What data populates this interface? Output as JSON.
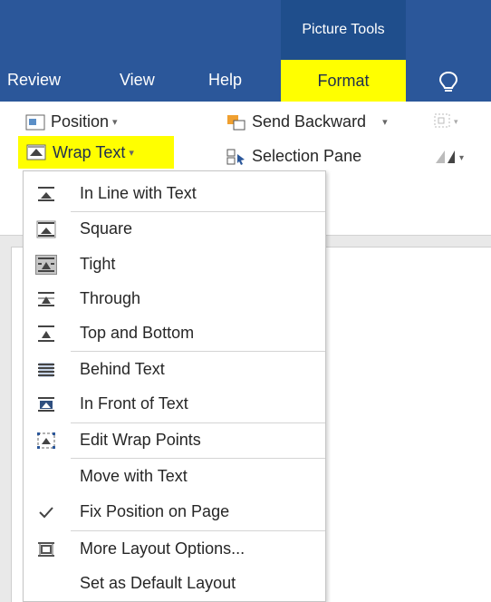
{
  "ribbon": {
    "context_group": "Picture Tools",
    "tabs": [
      "Review",
      "View",
      "Help"
    ],
    "active_tab": "Format",
    "tell_me_icon": "lightbulb-icon",
    "colors": {
      "ribbon_blue": "#2b579a",
      "highlight": "#ffff00"
    }
  },
  "commands": {
    "position": "Position",
    "wrap_text": "Wrap Text",
    "send_backward": "Send Backward",
    "selection_pane": "Selection Pane"
  },
  "menu": {
    "items": [
      {
        "label": "In Line with Text",
        "icon": "inline-wrap-icon"
      },
      {
        "label": "Square",
        "icon": "square-wrap-icon"
      },
      {
        "label": "Tight",
        "icon": "tight-wrap-icon",
        "selected": true
      },
      {
        "label": "Through",
        "icon": "through-wrap-icon"
      },
      {
        "label": "Top and Bottom",
        "icon": "top-bottom-wrap-icon"
      },
      {
        "label": "Behind Text",
        "icon": "behind-text-icon"
      },
      {
        "label": "In Front of Text",
        "icon": "in-front-text-icon"
      },
      {
        "label": "Edit Wrap Points",
        "icon": "edit-wrap-points-icon"
      },
      {
        "label": "Move with Text",
        "icon": ""
      },
      {
        "label": "Fix Position on Page",
        "icon": "checkmark-icon",
        "checked": true
      },
      {
        "label": "More Layout Options...",
        "icon": "layout-options-icon"
      },
      {
        "label": "Set as Default Layout",
        "icon": ""
      }
    ]
  }
}
